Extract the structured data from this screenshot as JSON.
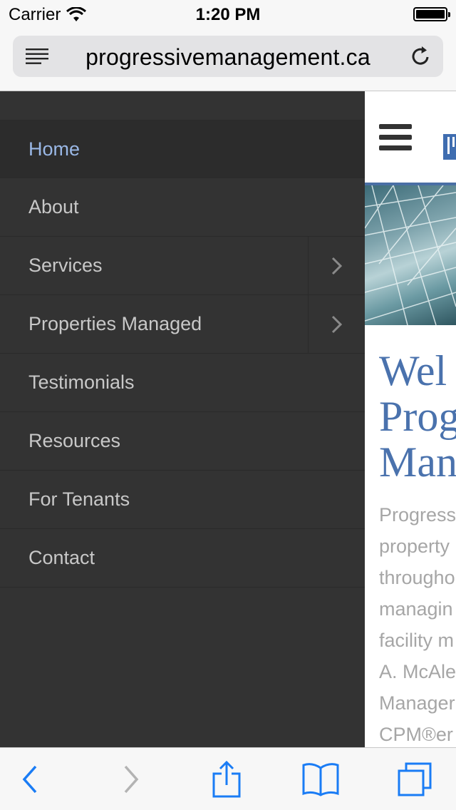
{
  "status_bar": {
    "carrier": "Carrier",
    "time": "1:20 PM",
    "battery_level": 1.0
  },
  "address_bar": {
    "url": "progressivemanagement.ca",
    "reader_icon": "reader-lines-icon",
    "reload_icon": "reload-icon"
  },
  "side_menu": {
    "items": [
      {
        "label": "Home",
        "active": true,
        "has_submenu": false
      },
      {
        "label": "About",
        "active": false,
        "has_submenu": false
      },
      {
        "label": "Services",
        "active": false,
        "has_submenu": true
      },
      {
        "label": "Properties Managed",
        "active": false,
        "has_submenu": true
      },
      {
        "label": "Testimonials",
        "active": false,
        "has_submenu": false
      },
      {
        "label": "Resources",
        "active": false,
        "has_submenu": false
      },
      {
        "label": "For Tenants",
        "active": false,
        "has_submenu": false
      },
      {
        "label": "Contact",
        "active": false,
        "has_submenu": false
      }
    ]
  },
  "page": {
    "welcome_lines": [
      "Wel",
      "Prog",
      "Man"
    ],
    "intro_lines": [
      "Progress",
      "property",
      "througho",
      "managin",
      "facility m",
      "A. McAle",
      "Manager",
      "CPM®er"
    ]
  },
  "toolbar": {
    "back_icon": "back-chevron-icon",
    "forward_icon": "forward-chevron-icon",
    "share_icon": "share-icon",
    "bookmarks_icon": "bookmarks-book-icon",
    "tabs_icon": "tabs-icon"
  },
  "colors": {
    "accent_blue": "#1a7cf5",
    "menu_bg": "#333333",
    "menu_active": "#9ab8e6",
    "heading_blue": "#4a72ad"
  }
}
